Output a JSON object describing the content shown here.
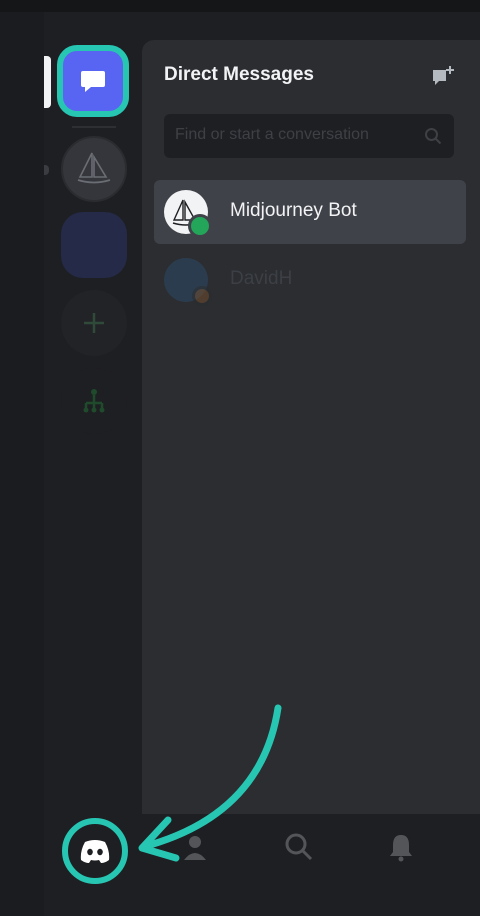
{
  "dm_panel": {
    "title": "Direct Messages",
    "search_placeholder": "Find or start a conversation",
    "conversations": [
      {
        "name": "Midjourney Bot",
        "status": "online",
        "selected": true
      },
      {
        "name": "DavidH",
        "status": "idle",
        "selected": false
      }
    ]
  },
  "server_rail": {
    "items": [
      "direct-messages",
      "midjourney-server",
      "blue-server",
      "add-server",
      "explore-servers"
    ]
  },
  "bottom_nav": {
    "items": [
      "home",
      "friends",
      "search",
      "notifications"
    ]
  },
  "colors": {
    "accent_highlight": "#27c6b3",
    "blurple": "#5865f2",
    "online": "#23a55a",
    "panel": "#2b2d31",
    "rail": "#1e1f22"
  },
  "icons": {
    "dm": "chat-bubble-icon",
    "new_dm": "new-message-icon",
    "search": "search-icon",
    "home": "discord-logo-icon",
    "friends": "friends-icon",
    "bell": "bell-icon",
    "add": "plus-icon",
    "explore": "hierarchy-icon"
  }
}
